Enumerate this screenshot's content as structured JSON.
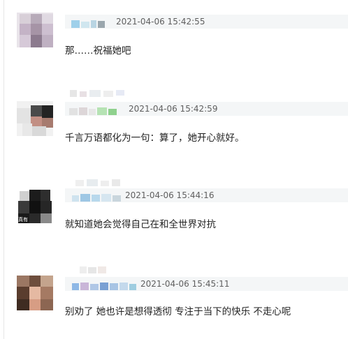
{
  "comments": [
    {
      "timestamp": "2021-04-06 15:42:55",
      "text": "那……祝福她吧"
    },
    {
      "timestamp": "2021-04-06 15:42:59",
      "text": "千言万语都化为一句：算了，她开心就好。"
    },
    {
      "timestamp": "2021-04-06 15:44:16",
      "text": "就知道她会觉得自己在和全世界对抗"
    },
    {
      "timestamp": "2021-04-06 15:45:11",
      "text": "别劝了 她也许是想得透彻 专注于当下的快乐 不走心呢"
    }
  ],
  "avatar_labels": [
    "真有"
  ],
  "colors": {
    "meta_bar": "#f4f6f7",
    "timestamp": "#5f5f5f",
    "text": "#222222",
    "border": "#e6e6e6"
  }
}
